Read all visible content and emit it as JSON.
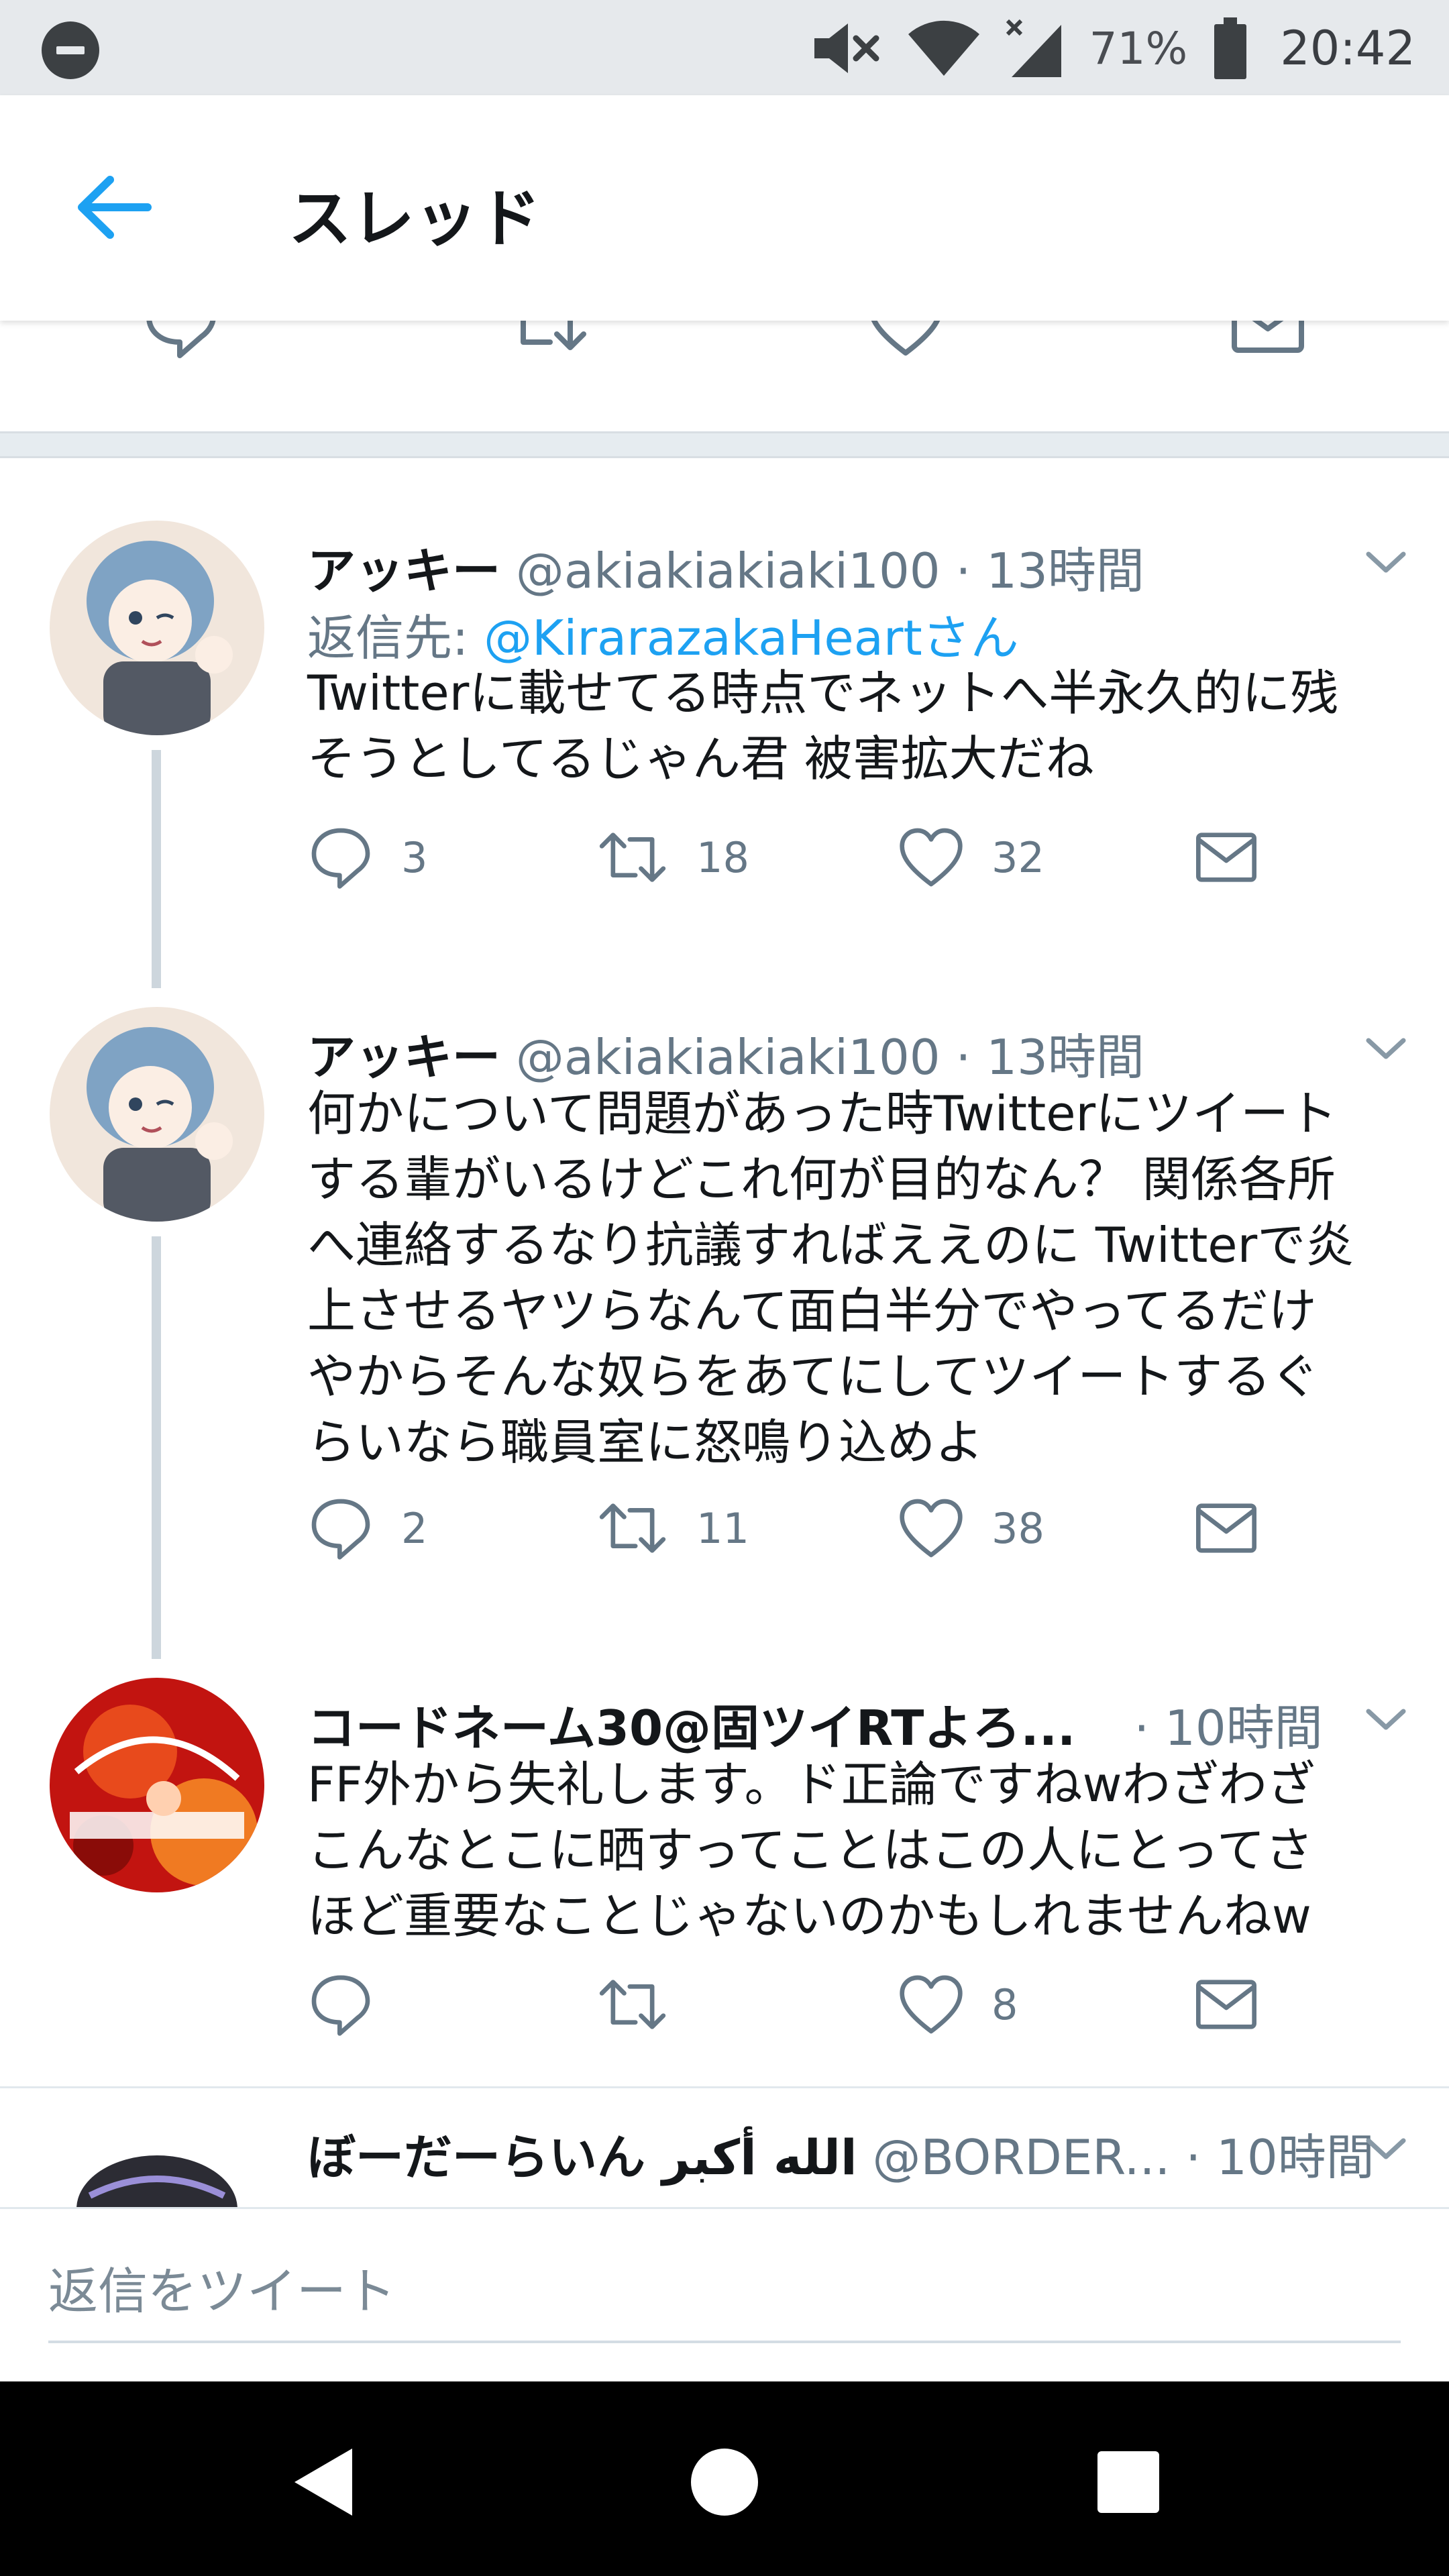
{
  "status_bar": {
    "battery_percent": "71%",
    "time": "20:42",
    "icons": [
      "do-not-disturb-icon",
      "mute-icon",
      "wifi-icon",
      "signal-icon",
      "battery-icon"
    ]
  },
  "app_bar": {
    "title": "スレッド",
    "back_icon": "back-arrow-icon"
  },
  "tweets": [
    {
      "name": "アッキー",
      "handle": "@akiakiakiaki100",
      "time": "· 13時間",
      "reply_label": "返信先:",
      "reply_mention": "@KirarazakaHeartさん",
      "lines": [
        "Twitterに載せてる時点でネットへ半永久的に残",
        "そうとしてるじゃん君 被害拡大だね"
      ],
      "replies": "3",
      "retweets": "18",
      "likes": "32"
    },
    {
      "name": "アッキー",
      "handle": "@akiakiakiaki100",
      "time": "· 13時間",
      "lines": [
        "何かについて問題があった時Twitterにツイート",
        "する輩がいるけどこれ何が目的なん？ 関係各所",
        "へ連絡するなり抗議すればええのに Twitterで炎",
        "上させるヤツらなんて面白半分でやってるだけ",
        "やからそんな奴らをあてにしてツイートするぐ",
        "らいなら職員室に怒鳴り込めよ"
      ],
      "replies": "2",
      "retweets": "11",
      "likes": "38"
    },
    {
      "name": "コードネーム30@固ツイRTよろ...",
      "handle": "",
      "time": "· 10時間",
      "lines": [
        "FF外から失礼します。ド正論ですねwわざわざ",
        "こんなとこに晒すってことはこの人にとってさ",
        "ほど重要なことじゃないのかもしれませんねw"
      ],
      "replies": "",
      "retweets": "",
      "likes": "8"
    },
    {
      "name": "ぼーだーらいん الله أكبر",
      "handle": "@BORDER...",
      "time": "· 10時間"
    }
  ],
  "composer": {
    "placeholder": "返信をツイート"
  },
  "colors": {
    "accent": "#1da1f2",
    "secondary_text": "#657786",
    "thread_line": "#cdd6dd"
  }
}
